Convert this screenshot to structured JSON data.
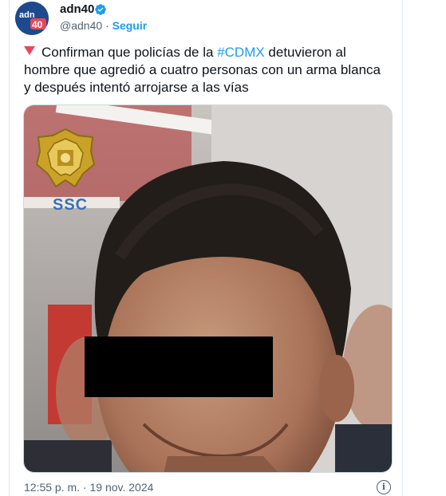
{
  "author": {
    "name": "adn40",
    "handle": "@adn40",
    "separator": "·",
    "follow_label": "Seguir",
    "avatar_text": "adn40"
  },
  "tweet": {
    "text_before_hashtag": "Confirman que policías de la ",
    "hashtag": "#CDMX",
    "text_after_hashtag": " detuvieron al hombre que agredió a cuatro personas con un arma blanca y después intentó arrojarse a las vías",
    "lead_icon": "red-triangle-down-icon"
  },
  "media": {
    "watermark_label": "SSC",
    "description_icon": "photo"
  },
  "footer": {
    "timestamp": "12:55 p. m. · 19 nov. 2024",
    "info_icon": "info-icon"
  },
  "colors": {
    "link": "#1d9bf0",
    "text": "#0f1419",
    "muted": "#536471",
    "triangle": "#e8475a",
    "avatar_bg": "#1c4a8c"
  }
}
